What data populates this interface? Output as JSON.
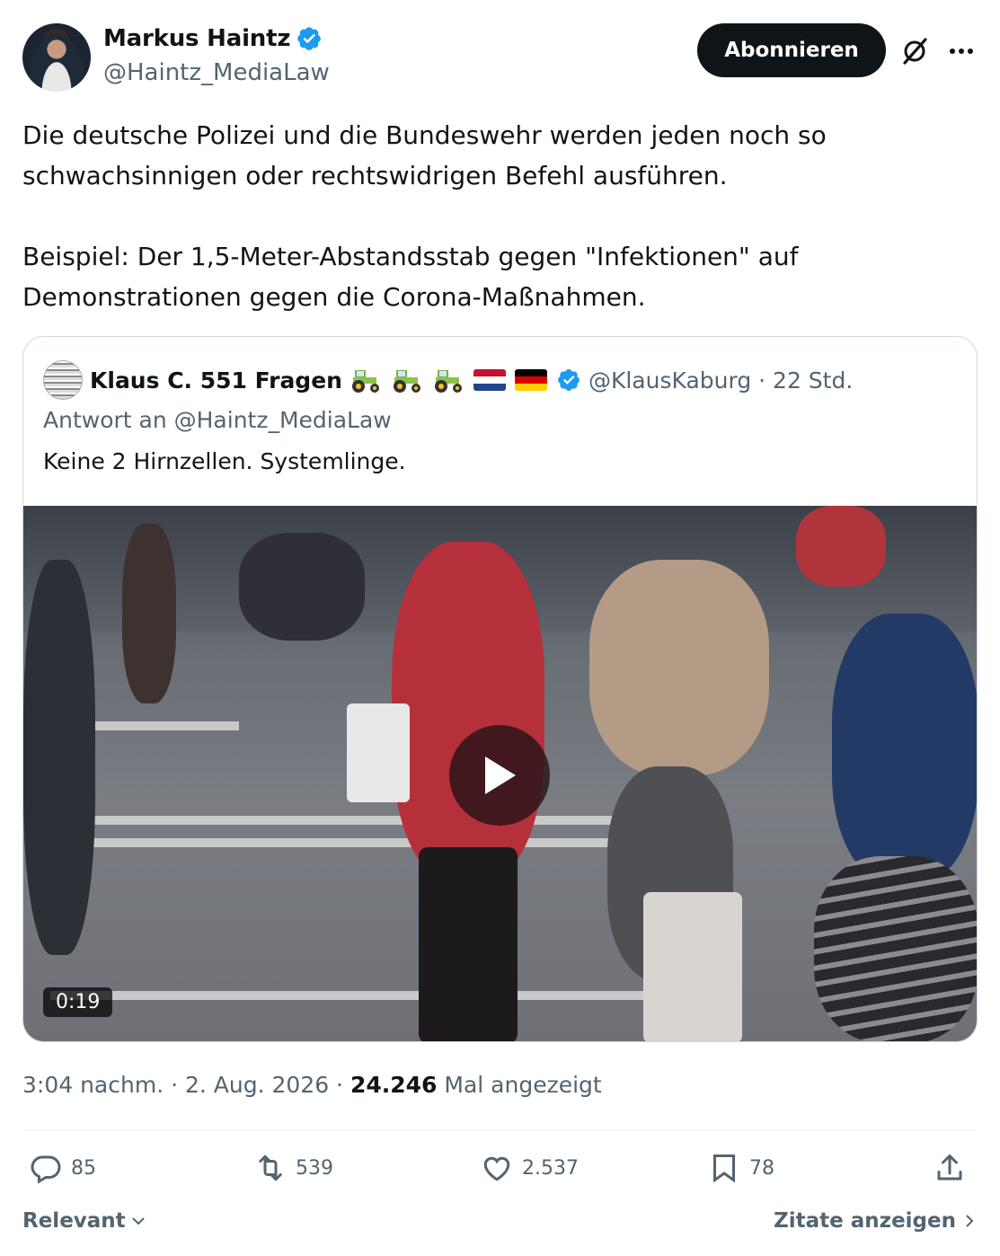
{
  "author": {
    "name": "Markus Haintz",
    "handle": "@Haintz_MediaLaw",
    "follow_label": "Abonnieren"
  },
  "tweet": {
    "text": "Die deutsche Polizei und die Bundeswehr werden jeden noch so schwachsinnigen oder rechtswidrigen Befehl ausführen.\n\nBeispiel: Der 1,5-Meter-Abstandsstab gegen \"Infektionen\" auf Demonstrationen gegen die Corona-Maßnahmen."
  },
  "quoted": {
    "name": "Klaus C. 551 Fragen",
    "handle": "@KlausKaburg · 22 Std.",
    "reply_to": "Antwort an @Haintz_MediaLaw",
    "text": "Keine 2 Hirnzellen. Systemlinge.",
    "video_duration": "0:19"
  },
  "meta": {
    "timestamp": "3:04 nachm. · 2. Aug. 2026 · ",
    "views_count": "24.246",
    "views_label": " Mal angezeigt"
  },
  "actions": {
    "replies": "85",
    "reposts": "539",
    "likes": "2.537",
    "bookmarks": "78"
  },
  "footer": {
    "sort_label": "Relevant",
    "quotes_label": "Zitate anzeigen"
  },
  "icons": [
    "verified-icon",
    "grok-icon",
    "more-icon",
    "play-icon",
    "reply-icon",
    "repost-icon",
    "like-icon",
    "bookmark-icon",
    "share-icon",
    "chevron-down-icon",
    "chevron-right-icon"
  ],
  "colors": {
    "verified": "#1d9bf0",
    "button_bg": "#0f1419",
    "secondary_text": "#536471"
  }
}
